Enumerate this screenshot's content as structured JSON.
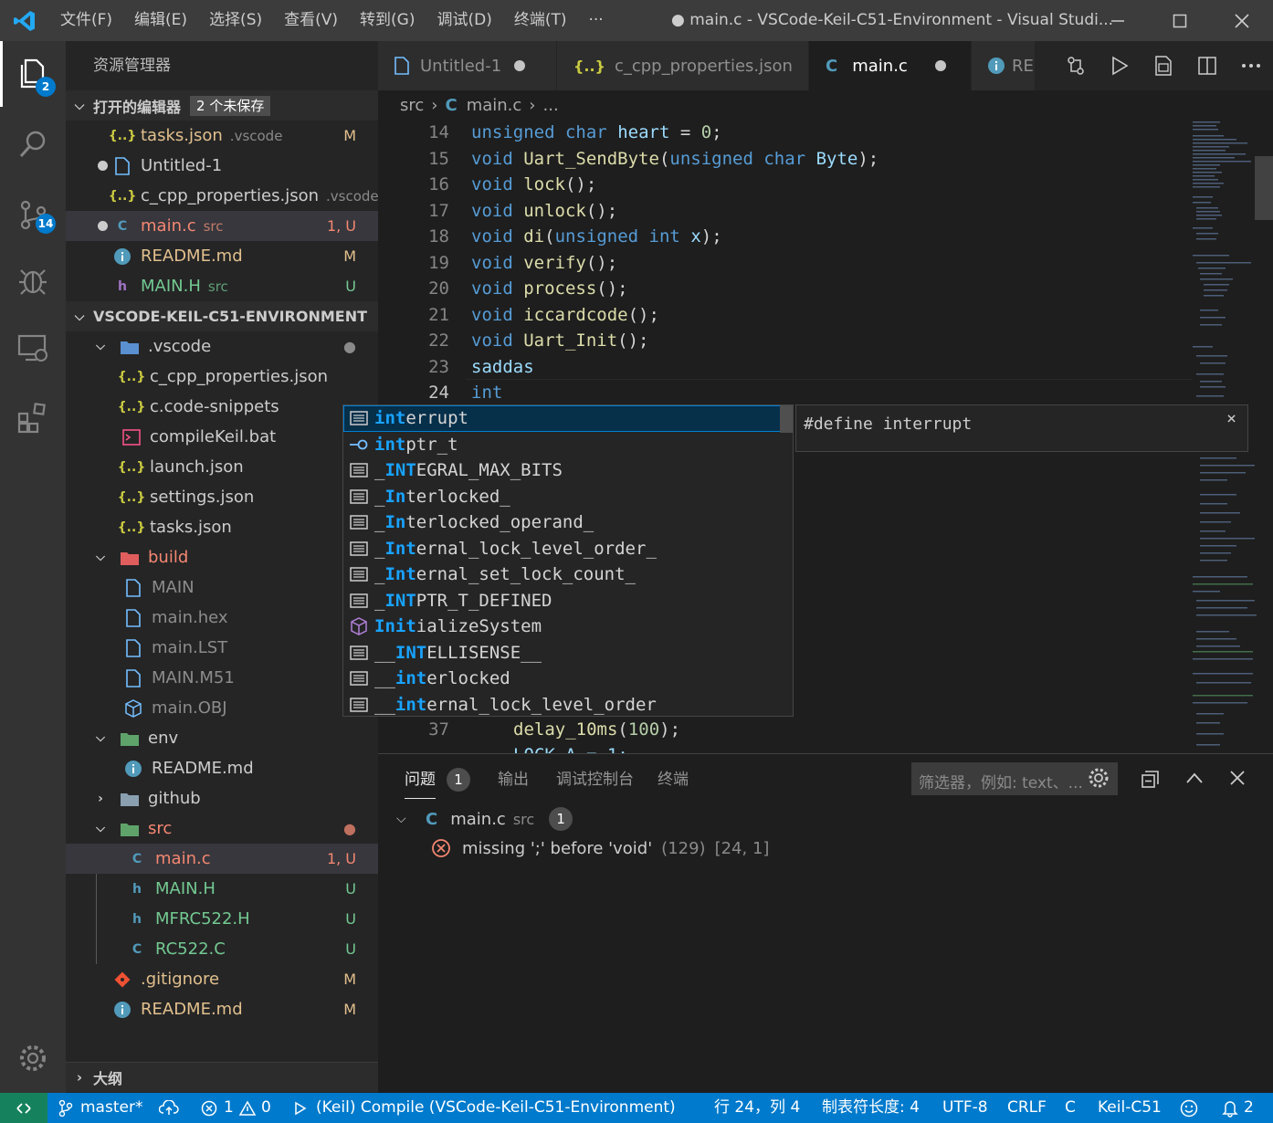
{
  "titlebar": {
    "menu": [
      "文件(F)",
      "编辑(E)",
      "选择(S)",
      "查看(V)",
      "转到(G)",
      "调试(D)",
      "终端(T)",
      "···"
    ],
    "title": "● main.c - VSCode-Keil-C51-Environment - Visual Studi..."
  },
  "activity": {
    "explorer_badge": "2",
    "scm_badge": "14"
  },
  "sidebar": {
    "title": "资源管理器",
    "open_editors": {
      "label": "打开的编辑器",
      "unsaved": "2 个未保存"
    },
    "open_files": [
      {
        "name": "tasks.json",
        "sub": ".vscode",
        "status": "M",
        "icon": "{..}"
      },
      {
        "name": "Untitled-1",
        "sub": "",
        "status": "",
        "icon": "file"
      },
      {
        "name": "c_cpp_properties.json",
        "sub": ".vscode",
        "status": "",
        "icon": "{..}"
      },
      {
        "name": "main.c",
        "sub": "src",
        "status": "1, U",
        "icon": "C"
      },
      {
        "name": "README.md",
        "sub": "",
        "status": "M",
        "icon": "info"
      },
      {
        "name": "MAIN.H",
        "sub": "src",
        "status": "U",
        "icon": "h"
      }
    ],
    "project": "VSCODE-KEIL-C51-ENVIRONMENT",
    "tree": [
      {
        "name": ".vscode",
        "status": "●"
      },
      {
        "name": "c_cpp_properties.json",
        "status": ""
      },
      {
        "name": "c.code-snippets",
        "status": ""
      },
      {
        "name": "compileKeil.bat",
        "status": ""
      },
      {
        "name": "launch.json",
        "status": ""
      },
      {
        "name": "settings.json",
        "status": ""
      },
      {
        "name": "tasks.json",
        "status": ""
      },
      {
        "name": "build",
        "status": ""
      },
      {
        "name": "MAIN",
        "status": ""
      },
      {
        "name": "main.hex",
        "status": ""
      },
      {
        "name": "main.LST",
        "status": ""
      },
      {
        "name": "MAIN.M51",
        "status": ""
      },
      {
        "name": "main.OBJ",
        "status": ""
      },
      {
        "name": "env",
        "status": ""
      },
      {
        "name": "README.md",
        "status": ""
      },
      {
        "name": "github",
        "status": ""
      },
      {
        "name": "src",
        "status": "●"
      },
      {
        "name": "main.c",
        "status": "1, U"
      },
      {
        "name": "MAIN.H",
        "status": "U"
      },
      {
        "name": "MFRC522.H",
        "status": "U"
      },
      {
        "name": "RC522.C",
        "status": "U"
      },
      {
        "name": ".gitignore",
        "status": "M"
      },
      {
        "name": "README.md",
        "status": "M"
      }
    ],
    "outline": "大纲"
  },
  "tabs": [
    "Untitled-1",
    "c_cpp_properties.json",
    "main.c",
    "RE"
  ],
  "breadcrumb": {
    "folder": "src",
    "file": "main.c",
    "more": "..."
  },
  "editor": {
    "line_numbers": [
      "14",
      "15",
      "16",
      "17",
      "18",
      "19",
      "20",
      "21",
      "22",
      "23",
      "24"
    ],
    "tail_line_numbers": [
      "37"
    ],
    "tail_code": "delay_10ms(100);"
  },
  "suggest": {
    "items": [
      {
        "pre": "",
        "match": "int",
        "post": "errupt",
        "icon": "text"
      },
      {
        "pre": "",
        "match": "int",
        "post": "ptr_t",
        "icon": "var"
      },
      {
        "pre": "_",
        "match": "INT",
        "post": "EGRAL_MAX_BITS",
        "icon": "text"
      },
      {
        "pre": "_",
        "match": "In",
        "post": "terlocked_",
        "icon": "text"
      },
      {
        "pre": "_",
        "match": "In",
        "post": "terlocked_operand_",
        "icon": "text"
      },
      {
        "pre": "_",
        "match": "Int",
        "post": "ernal_lock_level_order_",
        "icon": "text"
      },
      {
        "pre": "_",
        "match": "Int",
        "post": "ernal_set_lock_count_",
        "icon": "text"
      },
      {
        "pre": "_",
        "match": "INT",
        "post": "PTR_T_DEFINED",
        "icon": "text"
      },
      {
        "pre": "",
        "match": "Init",
        "post": "ializeSystem",
        "icon": "cube"
      },
      {
        "pre": "__",
        "match": "INT",
        "post": "ELLISENSE__",
        "icon": "text"
      },
      {
        "pre": "__",
        "match": "int",
        "post": "erlocked",
        "icon": "text"
      },
      {
        "pre": "__",
        "match": "int",
        "post": "ernal_lock_level_order",
        "icon": "text"
      }
    ],
    "detail": "#define interrupt"
  },
  "panel": {
    "tabs": [
      "问题",
      "输出",
      "调试控制台",
      "终端"
    ],
    "problem_count": "1",
    "filter_placeholder": "筛选器，例如: text、...",
    "file": "main.c",
    "file_dir": "src",
    "file_count": "1",
    "error_msg": "missing ';' before 'void'",
    "error_code": "(129)",
    "error_pos": "[24, 1]"
  },
  "status": {
    "branch": "master*",
    "errors": "1",
    "warnings": "0",
    "task": "(Keil) Compile (VSCode-Keil-C51-Environment)",
    "position": "行 24，列 4",
    "tabsize": "制表符长度: 4",
    "encoding": "UTF-8",
    "eol": "CRLF",
    "lang": "C",
    "config": "Keil-C51",
    "notifications": "2"
  }
}
